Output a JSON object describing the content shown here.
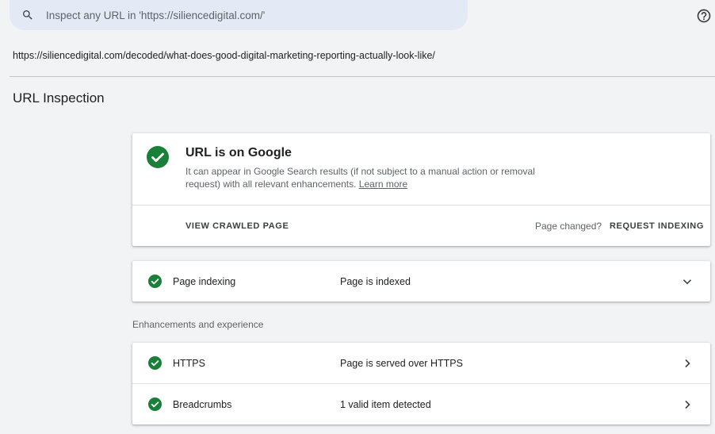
{
  "search": {
    "placeholder": "Inspect any URL in 'https://siliencedigital.com/'"
  },
  "inspected_url": "https://siliencedigital.com/decoded/what-does-good-digital-marketing-reporting-actually-look-like/",
  "page_title": "URL Inspection",
  "status": {
    "title": "URL is on Google",
    "description": "It can appear in Google Search results (if not subject to a manual action or removal request) with all relevant enhancements.",
    "learn_more": "Learn more",
    "view_crawled": "VIEW CRAWLED PAGE",
    "page_changed": "Page changed?",
    "request_indexing": "REQUEST INDEXING"
  },
  "indexing": {
    "label": "Page indexing",
    "value": "Page is indexed"
  },
  "enhancements": {
    "section_label": "Enhancements and experience",
    "items": [
      {
        "label": "HTTPS",
        "value": "Page is served over HTTPS"
      },
      {
        "label": "Breadcrumbs",
        "value": "1 valid item detected"
      }
    ]
  },
  "colors": {
    "success_green": "#188038",
    "background": "#f1f3f4",
    "search_bg": "#e3e9f5"
  },
  "icons": {
    "search": "search-icon",
    "help": "help-icon",
    "check": "check-circle-icon",
    "expand": "chevron-down-icon",
    "open": "chevron-right-icon"
  }
}
